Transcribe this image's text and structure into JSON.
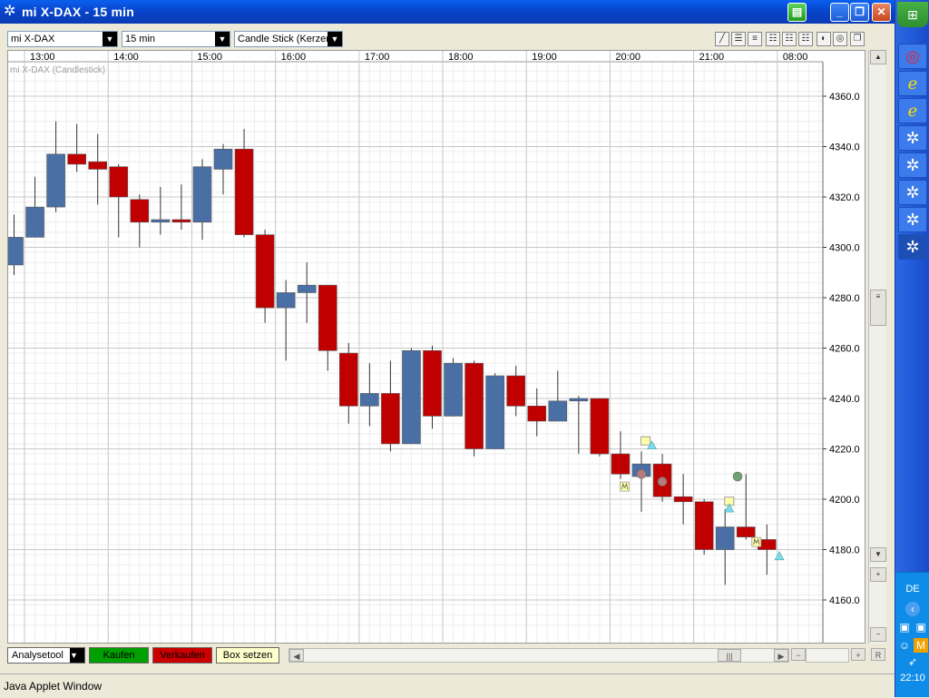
{
  "window": {
    "title": "mi X-DAX - 15 min",
    "minimize_label": "_",
    "maximize_label": "❐",
    "close_label": "✕"
  },
  "toolbar": {
    "symbol_value": "mi X-DAX",
    "interval_value": "15 min",
    "charttype_value": "Candle Stick (Kerzen)"
  },
  "chart_caption": "mi X-DAX (Candlestick)",
  "bottom": {
    "analysetool_label": "Analysetool",
    "buy_label": "Kaufen",
    "sell_label": "Verkaufen",
    "box_label": "Box setzen",
    "r_label": "R",
    "buy_color": "#00A000",
    "sell_color": "#CC0000",
    "box_color": "#FFFFCC"
  },
  "status": {
    "text": "Java Applet Window"
  },
  "taskbar": {
    "language": "DE",
    "clock": "22:10"
  },
  "chart_data": {
    "type": "candlestick",
    "title": "mi X-DAX (Candlestick)",
    "ylim": [
      4150,
      4370
    ],
    "y_ticks": [
      "4160.0",
      "4180.0",
      "4200.0",
      "4220.0",
      "4240.0",
      "4260.0",
      "4280.0",
      "4300.0",
      "4320.0",
      "4340.0",
      "4360.0"
    ],
    "x_ticks": [
      {
        "label": "13:00",
        "index": 0.5
      },
      {
        "label": "14:00",
        "index": 4.5
      },
      {
        "label": "15:00",
        "index": 8.5
      },
      {
        "label": "16:00",
        "index": 12.5
      },
      {
        "label": "17:00",
        "index": 16.5
      },
      {
        "label": "18:00",
        "index": 20.5
      },
      {
        "label": "19:00",
        "index": 24.5
      },
      {
        "label": "20:00",
        "index": 28.5
      },
      {
        "label": "21:00",
        "index": 32.5
      },
      {
        "label": "08:00",
        "index": 36.5
      }
    ],
    "up_color": "#4A6FA5",
    "down_color": "#C00000",
    "candles": [
      {
        "o": 4293,
        "h": 4313,
        "l": 4289,
        "c": 4304
      },
      {
        "o": 4304,
        "h": 4328,
        "l": 4304,
        "c": 4316
      },
      {
        "o": 4316,
        "h": 4350,
        "l": 4314,
        "c": 4337
      },
      {
        "o": 4337,
        "h": 4349,
        "l": 4330,
        "c": 4333
      },
      {
        "o": 4334,
        "h": 4345,
        "l": 4317,
        "c": 4331
      },
      {
        "o": 4332,
        "h": 4333,
        "l": 4304,
        "c": 4320
      },
      {
        "o": 4319,
        "h": 4321,
        "l": 4300,
        "c": 4310
      },
      {
        "o": 4310,
        "h": 4324,
        "l": 4305,
        "c": 4311
      },
      {
        "o": 4311,
        "h": 4325,
        "l": 4307,
        "c": 4310
      },
      {
        "o": 4310,
        "h": 4335,
        "l": 4303,
        "c": 4332
      },
      {
        "o": 4331,
        "h": 4341,
        "l": 4321,
        "c": 4339
      },
      {
        "o": 4339,
        "h": 4347,
        "l": 4304,
        "c": 4305
      },
      {
        "o": 4305,
        "h": 4307,
        "l": 4270,
        "c": 4276
      },
      {
        "o": 4276,
        "h": 4287,
        "l": 4255,
        "c": 4282
      },
      {
        "o": 4282,
        "h": 4294,
        "l": 4270,
        "c": 4285
      },
      {
        "o": 4285,
        "h": 4285,
        "l": 4251,
        "c": 4259
      },
      {
        "o": 4258,
        "h": 4262,
        "l": 4230,
        "c": 4237
      },
      {
        "o": 4237,
        "h": 4254,
        "l": 4229,
        "c": 4242
      },
      {
        "o": 4242,
        "h": 4255,
        "l": 4219,
        "c": 4222
      },
      {
        "o": 4222,
        "h": 4260,
        "l": 4222,
        "c": 4259
      },
      {
        "o": 4259,
        "h": 4261,
        "l": 4228,
        "c": 4233
      },
      {
        "o": 4233,
        "h": 4256,
        "l": 4233,
        "c": 4254
      },
      {
        "o": 4254,
        "h": 4255,
        "l": 4217,
        "c": 4220
      },
      {
        "o": 4220,
        "h": 4250,
        "l": 4220,
        "c": 4249
      },
      {
        "o": 4249,
        "h": 4253,
        "l": 4233,
        "c": 4237
      },
      {
        "o": 4237,
        "h": 4244,
        "l": 4225,
        "c": 4231
      },
      {
        "o": 4231,
        "h": 4251,
        "l": 4231,
        "c": 4239
      },
      {
        "o": 4239,
        "h": 4241,
        "l": 4218,
        "c": 4240
      },
      {
        "o": 4240,
        "h": 4240,
        "l": 4217,
        "c": 4218
      },
      {
        "o": 4218,
        "h": 4227,
        "l": 4208,
        "c": 4210
      },
      {
        "o": 4209,
        "h": 4219,
        "l": 4195,
        "c": 4214
      },
      {
        "o": 4214,
        "h": 4218,
        "l": 4199,
        "c": 4201
      },
      {
        "o": 4201,
        "h": 4210,
        "l": 4190,
        "c": 4199
      },
      {
        "o": 4199,
        "h": 4200,
        "l": 4178,
        "c": 4180
      },
      {
        "o": 4180,
        "h": 4196,
        "l": 4166,
        "c": 4189
      },
      {
        "o": 4189,
        "h": 4210,
        "l": 4184,
        "c": 4185
      },
      {
        "o": 4184,
        "h": 4190,
        "l": 4170,
        "c": 4180
      }
    ],
    "markers": [
      {
        "type": "square",
        "index": 30.2,
        "y": 4223,
        "color": "#FFFFAA"
      },
      {
        "type": "triangle-up",
        "index": 30.5,
        "y": 4221,
        "color": "#7EDBEA"
      },
      {
        "type": "circle",
        "index": 30.0,
        "y": 4210,
        "color": "#B57B7B"
      },
      {
        "type": "circle",
        "index": 31.0,
        "y": 4207,
        "color": "#B57B7B"
      },
      {
        "type": "m-box",
        "index": 29.2,
        "y": 4205,
        "color": "#FFFFAA"
      },
      {
        "type": "circle",
        "index": 34.6,
        "y": 4209,
        "color": "#6FA36F"
      },
      {
        "type": "square",
        "index": 34.2,
        "y": 4199,
        "color": "#FFFFAA"
      },
      {
        "type": "triangle-up",
        "index": 34.2,
        "y": 4196,
        "color": "#7EDBEA"
      },
      {
        "type": "m-box",
        "index": 35.5,
        "y": 4183,
        "color": "#FFFFAA"
      },
      {
        "type": "triangle-up",
        "index": 36.6,
        "y": 4177,
        "color": "#7EDBEA"
      }
    ]
  }
}
